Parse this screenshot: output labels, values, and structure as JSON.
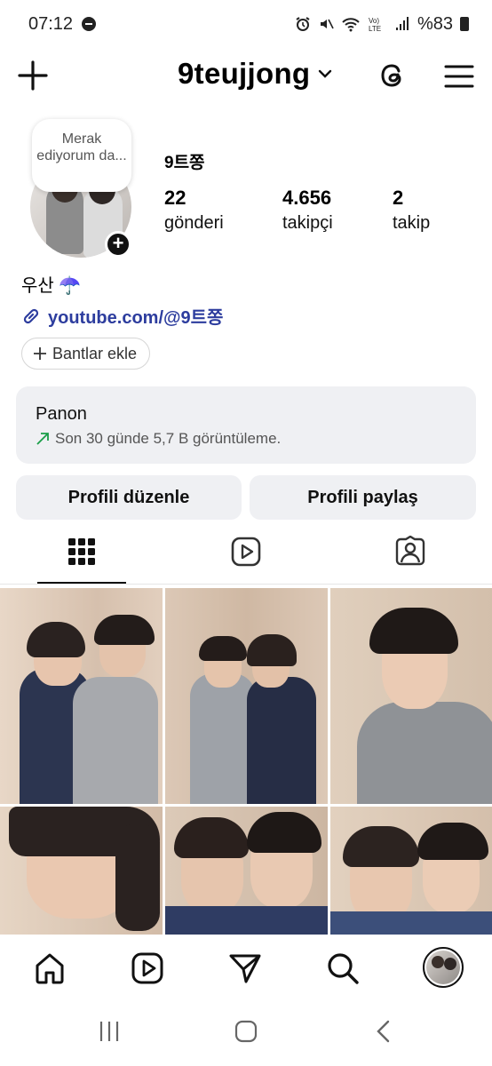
{
  "status_bar": {
    "time": "07:12",
    "battery": "%83"
  },
  "header": {
    "username": "9teujjong",
    "icons": [
      "plus-icon",
      "chevron-down-icon",
      "threads-icon",
      "menu-icon"
    ]
  },
  "profile": {
    "note": "Merak ediyorum da...",
    "display_name": "9트쫑",
    "stats": [
      {
        "value": "22",
        "label": "gönderi"
      },
      {
        "value": "4.656",
        "label": "takipçi"
      },
      {
        "value": "2",
        "label": "takip"
      }
    ],
    "bio": "우산 ☂️",
    "link": "youtube.com/@9트쫑",
    "add_banners": "Bantlar ekle"
  },
  "dashboard": {
    "title": "Panon",
    "subtitle": "Son 30 günde 5,7 B görüntüleme."
  },
  "actions": {
    "edit_profile": "Profili düzenle",
    "share_profile": "Profili paylaş"
  },
  "tabs": [
    "grid-icon",
    "reels-icon",
    "tagged-icon"
  ],
  "bottom_nav": [
    "home-icon",
    "reels-icon",
    "send-icon",
    "search-icon",
    "profile-avatar"
  ],
  "colors": {
    "link": "#2d3d9e",
    "button_bg": "#eff0f3",
    "trend_arrow": "#1a9e48"
  }
}
